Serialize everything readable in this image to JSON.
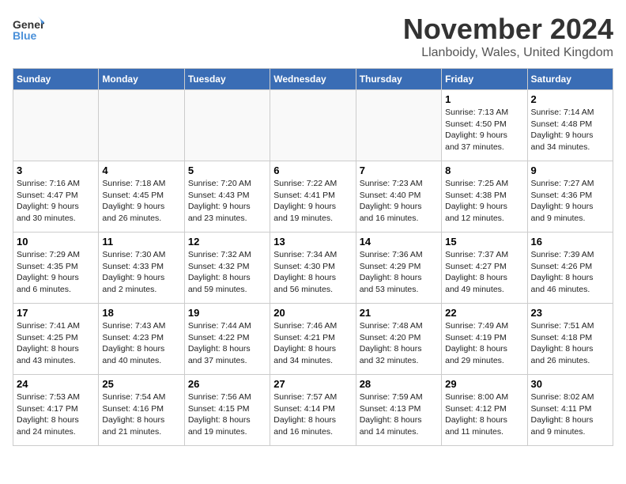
{
  "logo": {
    "general": "General",
    "blue": "Blue"
  },
  "title": "November 2024",
  "location": "Llanboidy, Wales, United Kingdom",
  "weekdays": [
    "Sunday",
    "Monday",
    "Tuesday",
    "Wednesday",
    "Thursday",
    "Friday",
    "Saturday"
  ],
  "weeks": [
    [
      {
        "day": "",
        "info": ""
      },
      {
        "day": "",
        "info": ""
      },
      {
        "day": "",
        "info": ""
      },
      {
        "day": "",
        "info": ""
      },
      {
        "day": "",
        "info": ""
      },
      {
        "day": "1",
        "info": "Sunrise: 7:13 AM\nSunset: 4:50 PM\nDaylight: 9 hours\nand 37 minutes."
      },
      {
        "day": "2",
        "info": "Sunrise: 7:14 AM\nSunset: 4:48 PM\nDaylight: 9 hours\nand 34 minutes."
      }
    ],
    [
      {
        "day": "3",
        "info": "Sunrise: 7:16 AM\nSunset: 4:47 PM\nDaylight: 9 hours\nand 30 minutes."
      },
      {
        "day": "4",
        "info": "Sunrise: 7:18 AM\nSunset: 4:45 PM\nDaylight: 9 hours\nand 26 minutes."
      },
      {
        "day": "5",
        "info": "Sunrise: 7:20 AM\nSunset: 4:43 PM\nDaylight: 9 hours\nand 23 minutes."
      },
      {
        "day": "6",
        "info": "Sunrise: 7:22 AM\nSunset: 4:41 PM\nDaylight: 9 hours\nand 19 minutes."
      },
      {
        "day": "7",
        "info": "Sunrise: 7:23 AM\nSunset: 4:40 PM\nDaylight: 9 hours\nand 16 minutes."
      },
      {
        "day": "8",
        "info": "Sunrise: 7:25 AM\nSunset: 4:38 PM\nDaylight: 9 hours\nand 12 minutes."
      },
      {
        "day": "9",
        "info": "Sunrise: 7:27 AM\nSunset: 4:36 PM\nDaylight: 9 hours\nand 9 minutes."
      }
    ],
    [
      {
        "day": "10",
        "info": "Sunrise: 7:29 AM\nSunset: 4:35 PM\nDaylight: 9 hours\nand 6 minutes."
      },
      {
        "day": "11",
        "info": "Sunrise: 7:30 AM\nSunset: 4:33 PM\nDaylight: 9 hours\nand 2 minutes."
      },
      {
        "day": "12",
        "info": "Sunrise: 7:32 AM\nSunset: 4:32 PM\nDaylight: 8 hours\nand 59 minutes."
      },
      {
        "day": "13",
        "info": "Sunrise: 7:34 AM\nSunset: 4:30 PM\nDaylight: 8 hours\nand 56 minutes."
      },
      {
        "day": "14",
        "info": "Sunrise: 7:36 AM\nSunset: 4:29 PM\nDaylight: 8 hours\nand 53 minutes."
      },
      {
        "day": "15",
        "info": "Sunrise: 7:37 AM\nSunset: 4:27 PM\nDaylight: 8 hours\nand 49 minutes."
      },
      {
        "day": "16",
        "info": "Sunrise: 7:39 AM\nSunset: 4:26 PM\nDaylight: 8 hours\nand 46 minutes."
      }
    ],
    [
      {
        "day": "17",
        "info": "Sunrise: 7:41 AM\nSunset: 4:25 PM\nDaylight: 8 hours\nand 43 minutes."
      },
      {
        "day": "18",
        "info": "Sunrise: 7:43 AM\nSunset: 4:23 PM\nDaylight: 8 hours\nand 40 minutes."
      },
      {
        "day": "19",
        "info": "Sunrise: 7:44 AM\nSunset: 4:22 PM\nDaylight: 8 hours\nand 37 minutes."
      },
      {
        "day": "20",
        "info": "Sunrise: 7:46 AM\nSunset: 4:21 PM\nDaylight: 8 hours\nand 34 minutes."
      },
      {
        "day": "21",
        "info": "Sunrise: 7:48 AM\nSunset: 4:20 PM\nDaylight: 8 hours\nand 32 minutes."
      },
      {
        "day": "22",
        "info": "Sunrise: 7:49 AM\nSunset: 4:19 PM\nDaylight: 8 hours\nand 29 minutes."
      },
      {
        "day": "23",
        "info": "Sunrise: 7:51 AM\nSunset: 4:18 PM\nDaylight: 8 hours\nand 26 minutes."
      }
    ],
    [
      {
        "day": "24",
        "info": "Sunrise: 7:53 AM\nSunset: 4:17 PM\nDaylight: 8 hours\nand 24 minutes."
      },
      {
        "day": "25",
        "info": "Sunrise: 7:54 AM\nSunset: 4:16 PM\nDaylight: 8 hours\nand 21 minutes."
      },
      {
        "day": "26",
        "info": "Sunrise: 7:56 AM\nSunset: 4:15 PM\nDaylight: 8 hours\nand 19 minutes."
      },
      {
        "day": "27",
        "info": "Sunrise: 7:57 AM\nSunset: 4:14 PM\nDaylight: 8 hours\nand 16 minutes."
      },
      {
        "day": "28",
        "info": "Sunrise: 7:59 AM\nSunset: 4:13 PM\nDaylight: 8 hours\nand 14 minutes."
      },
      {
        "day": "29",
        "info": "Sunrise: 8:00 AM\nSunset: 4:12 PM\nDaylight: 8 hours\nand 11 minutes."
      },
      {
        "day": "30",
        "info": "Sunrise: 8:02 AM\nSunset: 4:11 PM\nDaylight: 8 hours\nand 9 minutes."
      }
    ]
  ]
}
